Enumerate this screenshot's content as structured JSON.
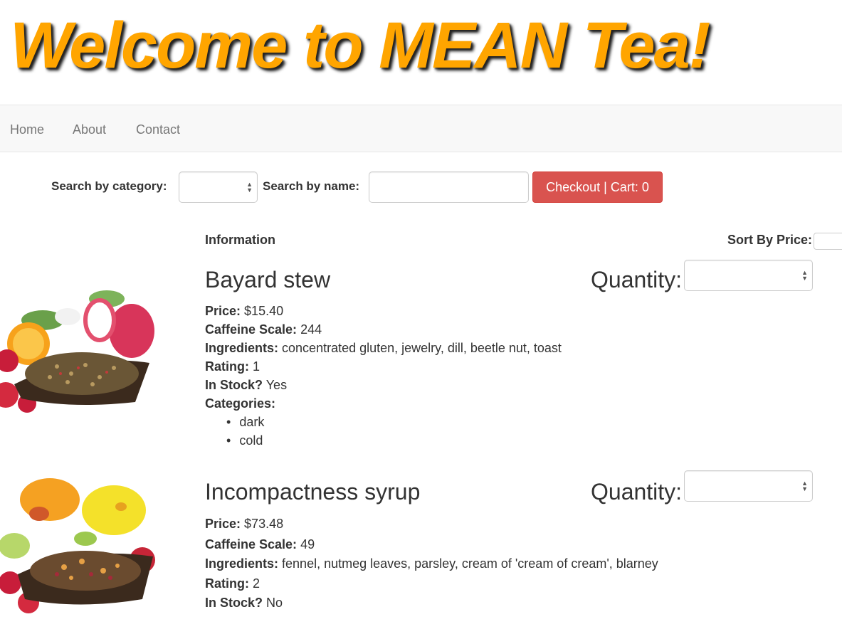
{
  "header": {
    "title": "Welcome to MEAN Tea!"
  },
  "nav": {
    "items": [
      {
        "label": "Home"
      },
      {
        "label": "About"
      },
      {
        "label": "Contact"
      }
    ]
  },
  "filters": {
    "category_label": "Search by category:",
    "category_value": "",
    "name_label": "Search by name:",
    "name_value": "",
    "checkout_label": "Checkout | Cart: 0"
  },
  "list_header": {
    "information": "Information",
    "sort_label": "Sort By Price:"
  },
  "labels": {
    "price": "Price:",
    "caffeine": "Caffeine Scale:",
    "ingredients": "Ingredients:",
    "rating": "Rating:",
    "in_stock": "In Stock?",
    "categories": "Categories:",
    "quantity": "Quantity:"
  },
  "products": [
    {
      "name": "Bayard stew",
      "price": "$15.40",
      "caffeine": "244",
      "ingredients": "concentrated gluten, jewelry, dill, beetle nut, toast",
      "rating": "1",
      "in_stock": "Yes",
      "categories": [
        "dark",
        "cold"
      ]
    },
    {
      "name": "Incompactness syrup",
      "price": "$73.48",
      "caffeine": "49",
      "ingredients": "fennel, nutmeg leaves, parsley, cream of 'cream of cream', blarney",
      "rating": "2",
      "in_stock": "No"
    }
  ],
  "colors": {
    "title": "#ffa500",
    "checkout": "#d9534f",
    "navbar_bg": "#f8f8f8"
  }
}
